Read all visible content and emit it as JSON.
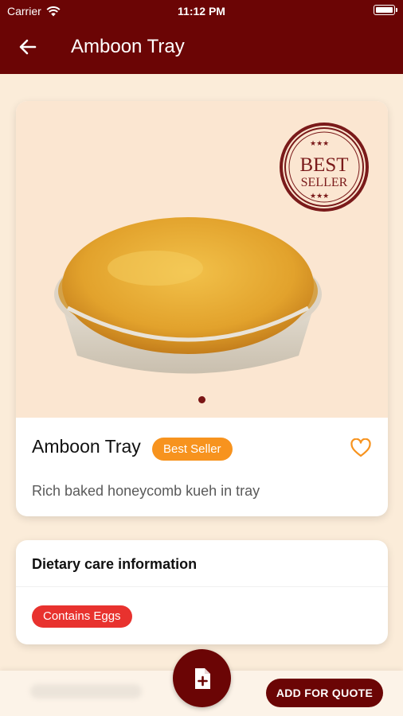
{
  "status_bar": {
    "carrier": "Carrier",
    "time": "11:12 PM"
  },
  "header": {
    "title": "Amboon Tray",
    "back_icon": "arrow-left-icon"
  },
  "product": {
    "seal_top": "BEST",
    "seal_bottom": "SELLER",
    "name": "Amboon Tray",
    "badge": "Best Seller",
    "description": "Rich baked honeycomb kueh in tray",
    "favorite_icon": "heart-outline-icon"
  },
  "dietary": {
    "title": "Dietary care information",
    "tags": [
      "Contains Eggs"
    ]
  },
  "actions": {
    "fab_icon": "add-document-icon",
    "quote_label": "ADD FOR QUOTE"
  },
  "colors": {
    "primary": "#6b0505",
    "background": "#fbecd9",
    "badge": "#f7931e",
    "allergen": "#e8322e"
  }
}
